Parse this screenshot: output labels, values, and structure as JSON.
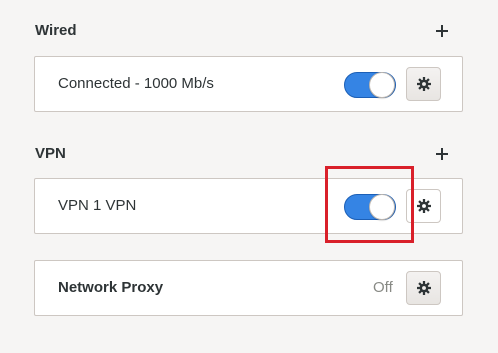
{
  "wired": {
    "title": "Wired",
    "add_icon": "plus-icon",
    "connection": {
      "label": "Connected - 1000 Mb/s",
      "enabled": true,
      "settings_icon": "gear-icon"
    }
  },
  "vpn": {
    "title": "VPN",
    "add_icon": "plus-icon",
    "connection": {
      "label": "VPN 1 VPN",
      "enabled": true,
      "settings_icon": "gear-icon"
    }
  },
  "proxy": {
    "label": "Network Proxy",
    "status": "Off",
    "settings_icon": "gear-icon"
  },
  "colors": {
    "accent": "#3584e4",
    "highlight": "#d9202a"
  }
}
